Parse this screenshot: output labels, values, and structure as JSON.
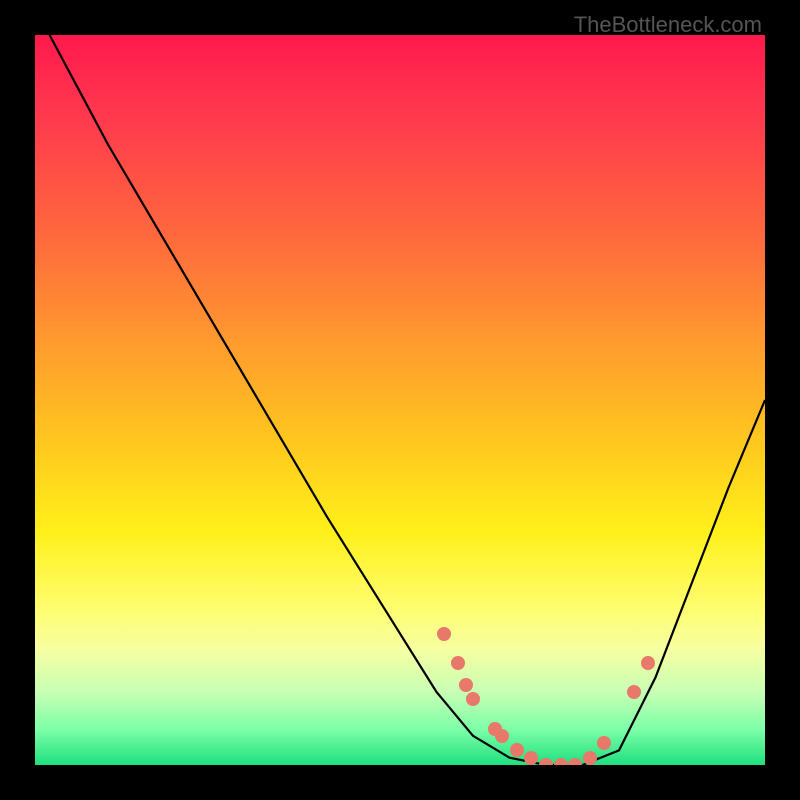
{
  "attribution": "TheBottleneck.com",
  "colors": {
    "curve_stroke": "#000000",
    "dot_fill": "#e8786a",
    "frame": "#000000"
  },
  "chart_data": {
    "type": "line",
    "title": "",
    "xlabel": "",
    "ylabel": "",
    "xlim": [
      0,
      100
    ],
    "ylim": [
      0,
      100
    ],
    "grid": false,
    "curve": {
      "name": "bottleneck-curve",
      "x": [
        2,
        10,
        20,
        30,
        40,
        50,
        55,
        60,
        65,
        70,
        75,
        80,
        85,
        90,
        95,
        100
      ],
      "y": [
        100,
        85,
        68,
        51,
        34,
        18,
        10,
        4,
        1,
        0,
        0,
        2,
        12,
        25,
        38,
        50
      ]
    },
    "scatter": {
      "name": "data-points",
      "x": [
        56,
        58,
        59,
        60,
        63,
        64,
        66,
        68,
        70,
        72,
        74,
        76,
        78,
        82,
        84
      ],
      "y": [
        18,
        14,
        11,
        9,
        5,
        4,
        2,
        1,
        0,
        0,
        0,
        1,
        3,
        10,
        14
      ]
    }
  }
}
